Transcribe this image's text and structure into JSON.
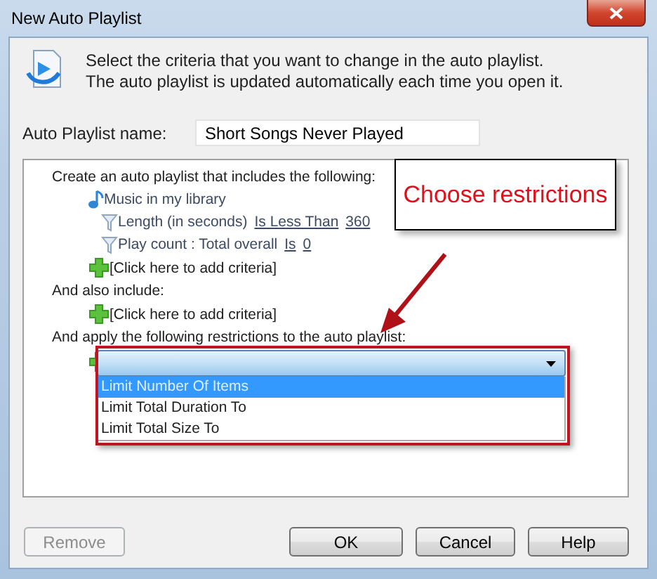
{
  "window": {
    "title": "New Auto Playlist"
  },
  "header": {
    "lines": [
      "Select the criteria that you want to change in the auto playlist.",
      "The auto playlist is updated automatically each time you open it."
    ]
  },
  "name_field": {
    "label": "Auto Playlist name:",
    "value": "Short Songs Never Played"
  },
  "criteria": {
    "sections": [
      {
        "heading": "Create an auto playlist that includes the following:",
        "items": [
          {
            "kind": "source",
            "text": "Music in my library",
            "children": [
              {
                "kind": "filter",
                "field": "Length (in seconds)",
                "operator": "Is Less Than",
                "value": "360"
              },
              {
                "kind": "filter",
                "field": "Play count : Total overall",
                "operator": "Is",
                "value": "0"
              }
            ]
          },
          {
            "kind": "add",
            "text": "[Click here to add criteria]"
          }
        ]
      },
      {
        "heading": "And also include:",
        "items": [
          {
            "kind": "add",
            "text": "[Click here to add criteria]"
          }
        ]
      },
      {
        "heading": "And apply the following restrictions to the auto playlist:",
        "items": [
          {
            "kind": "dropdown",
            "expanded": true,
            "options": [
              {
                "label": "Limit Number Of Items",
                "selected": true
              },
              {
                "label": "Limit Total Duration To",
                "selected": false
              },
              {
                "label": "Limit Total Size To",
                "selected": false
              }
            ]
          }
        ]
      }
    ]
  },
  "callout": {
    "text": "Choose restrictions"
  },
  "buttons": [
    {
      "label": "Remove",
      "disabled": true
    },
    {
      "label": "OK",
      "disabled": false
    },
    {
      "label": "Cancel",
      "disabled": false
    },
    {
      "label": "Help",
      "disabled": false
    }
  ]
}
